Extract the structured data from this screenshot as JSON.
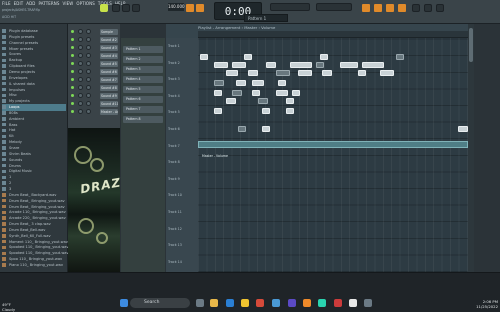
{
  "menubar": {
    "items": [
      "FILE",
      "EDIT",
      "ADD",
      "PATTERNS",
      "VIEW",
      "OPTIONS",
      "TOOLS",
      "HELP"
    ],
    "project": "projects/ASHES-TRAP.flp",
    "version": "ACID HIT"
  },
  "transport": {
    "tempo": "140.000",
    "time": "0:00",
    "time_unit": "00",
    "pattern": "Pattern 1"
  },
  "browser": {
    "items": [
      {
        "label": "Plugin database",
        "type": "folder"
      },
      {
        "label": "Plugin presets",
        "type": "folder"
      },
      {
        "label": "Channel presets",
        "type": "folder"
      },
      {
        "label": "Mixer presets",
        "type": "folder"
      },
      {
        "label": "Scores",
        "type": "folder"
      },
      {
        "label": "Backup",
        "type": "folder"
      },
      {
        "label": "Clipboard files",
        "type": "folder"
      },
      {
        "label": "Demo projects",
        "type": "folder"
      },
      {
        "label": "Envelopes",
        "type": "folder"
      },
      {
        "label": "IL shared data",
        "type": "folder"
      },
      {
        "label": "Impulses",
        "type": "folder"
      },
      {
        "label": "Misc",
        "type": "folder"
      },
      {
        "label": "My projects",
        "type": "folder"
      },
      {
        "label": "Loops",
        "type": "folder",
        "selected": true
      },
      {
        "label": "808s",
        "type": "folder"
      },
      {
        "label": "Ambient",
        "type": "folder"
      },
      {
        "label": "Bass",
        "type": "folder"
      },
      {
        "label": "Hat",
        "type": "folder"
      },
      {
        "label": "Kit",
        "type": "folder"
      },
      {
        "label": "Melody",
        "type": "folder"
      },
      {
        "label": "Snare",
        "type": "folder"
      },
      {
        "label": "Shrim Beats",
        "type": "folder"
      },
      {
        "label": "Sounds",
        "type": "folder"
      },
      {
        "label": "Drums",
        "type": "folder"
      },
      {
        "label": "Digital Music",
        "type": "folder"
      },
      {
        "label": "1",
        "type": "folder"
      },
      {
        "label": "2",
        "type": "folder"
      },
      {
        "label": "3",
        "type": "folder"
      },
      {
        "label": "Drum Beat_ Backyard.wav",
        "type": "file"
      },
      {
        "label": "Drum Beat_ Bringing_yout.wav",
        "type": "file"
      },
      {
        "label": "Drum Beat_ Bringing_yout.wav",
        "type": "file"
      },
      {
        "label": "Arcade 110_ Bringing_yout.wav",
        "type": "file"
      },
      {
        "label": "Arcade 220_ Bringing_yout.wav",
        "type": "file"
      },
      {
        "label": "Drum Beat_ 3 clap.wav",
        "type": "file"
      },
      {
        "label": "Drum Beat_Bell.wav",
        "type": "file"
      },
      {
        "label": "Synth_Bell_60_Full.wav",
        "type": "file"
      },
      {
        "label": "Moment 110_ Bringing_yout.wav",
        "type": "file"
      },
      {
        "label": "Spooked 110_ Bringing_yout.wav",
        "type": "file"
      },
      {
        "label": "Spooked 110_ Bringing_yout.wav",
        "type": "file"
      },
      {
        "label": "Spoo 110_ Bringing_yout.wav",
        "type": "file"
      },
      {
        "label": "Piano 110_ Bringing_yout.wav",
        "type": "file"
      }
    ]
  },
  "channels": [
    "Sample",
    "Sound #2",
    "Sound #3",
    "Sound #4",
    "Sound #5",
    "Sound #6",
    "Sound #7",
    "Sound #8",
    "Sound #9",
    "Sound #10",
    "Master - Ames"
  ],
  "patterns": [
    "Pattern 1",
    "Pattern 2",
    "Pattern 3",
    "Pattern 4",
    "Pattern 5",
    "Pattern 6",
    "Pattern 7",
    "Pattern 8"
  ],
  "playlist": {
    "title": "Playlist - Arrangement › Master › Volume",
    "tracks": [
      "Track 1",
      "Track 2",
      "Track 3",
      "Track 4",
      "Track 5",
      "Track 6",
      "Track 7",
      "Track 8",
      "Track 9",
      "Track 10",
      "Track 11",
      "Track 12",
      "Track 13",
      "Track 14"
    ],
    "automation_label": "Master - Volume"
  },
  "art": {
    "text": "DRAZY"
  },
  "taskbar": {
    "search": "Search",
    "weather_temp": "49°F",
    "weather_desc": "Cloudy",
    "time": "2:06 PM",
    "date": "11/25/2022"
  },
  "colors": {
    "accent": "#c7e24a",
    "selected": "#4e7c8c",
    "clip": "#c9d2d6",
    "automation": "#4f7e86"
  }
}
